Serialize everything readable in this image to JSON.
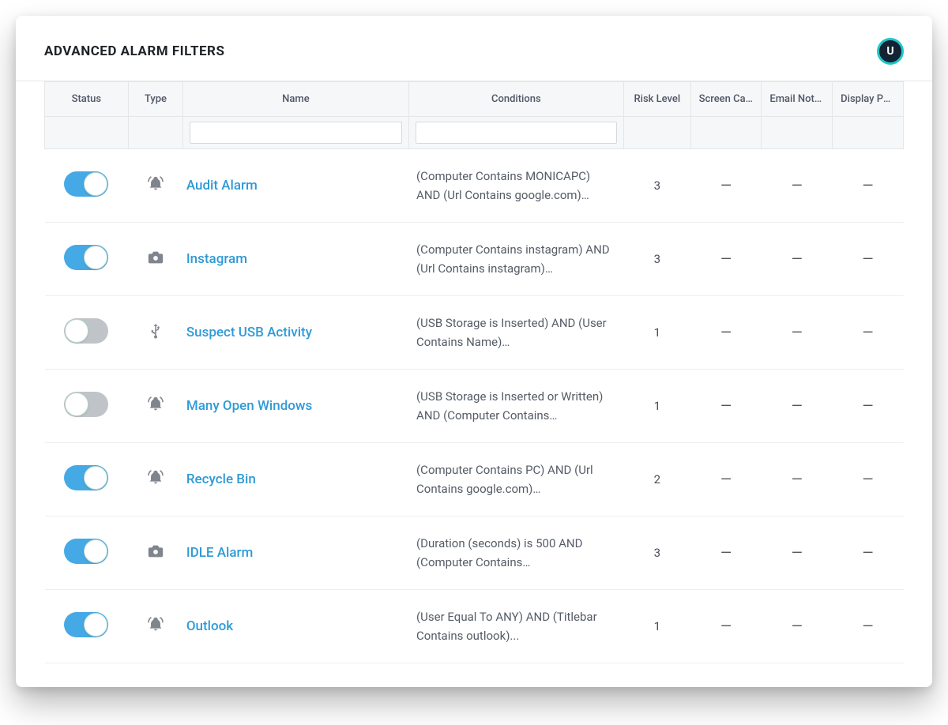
{
  "header": {
    "title": "ADVANCED ALARM FILTERS",
    "avatar_initial": "U"
  },
  "columns": {
    "status": "Status",
    "type": "Type",
    "name": "Name",
    "conditions": "Conditions",
    "risk": "Risk Level",
    "screen": "Screen Cap...",
    "email": "Email Noti...",
    "popup": "Display Pop..."
  },
  "em_dash": "—",
  "icons": {
    "bell": "bell",
    "camera": "camera",
    "usb": "usb"
  },
  "rows": [
    {
      "status_on": true,
      "icon": "bell",
      "name": "Audit Alarm",
      "conditions": "(Computer Contains MONICAPC) AND (Url Contains google.com)…",
      "risk": "3",
      "screen": "—",
      "email": "—",
      "popup": "—"
    },
    {
      "status_on": true,
      "icon": "camera",
      "name": "Instagram",
      "conditions": "(Computer Contains instagram) AND (Url Contains instagram)…",
      "risk": "3",
      "screen": "—",
      "email": "—",
      "popup": "—"
    },
    {
      "status_on": false,
      "icon": "usb",
      "name": "Suspect USB Activity",
      "conditions": "(USB Storage is Inserted) AND (User Contains Name)…",
      "risk": "1",
      "screen": "—",
      "email": "—",
      "popup": "—"
    },
    {
      "status_on": false,
      "icon": "bell",
      "name": "Many Open Windows",
      "conditions": "(USB Storage is Inserted or Written) AND (Computer Contains…",
      "risk": "1",
      "screen": "—",
      "email": "—",
      "popup": "—"
    },
    {
      "status_on": true,
      "icon": "bell",
      "name": "Recycle Bin",
      "conditions": "(Computer Contains PC) AND (Url Contains google.com)…",
      "risk": "2",
      "screen": "—",
      "email": "—",
      "popup": "—"
    },
    {
      "status_on": true,
      "icon": "camera",
      "name": "IDLE Alarm",
      "conditions": "(Duration (seconds) is 500 AND (Computer Contains…",
      "risk": "3",
      "screen": "—",
      "email": "—",
      "popup": "—"
    },
    {
      "status_on": true,
      "icon": "bell",
      "name": "Outlook",
      "conditions": "(User Equal To ANY) AND (Titlebar Contains outlook)...",
      "risk": "1",
      "screen": "—",
      "email": "—",
      "popup": "—"
    }
  ]
}
